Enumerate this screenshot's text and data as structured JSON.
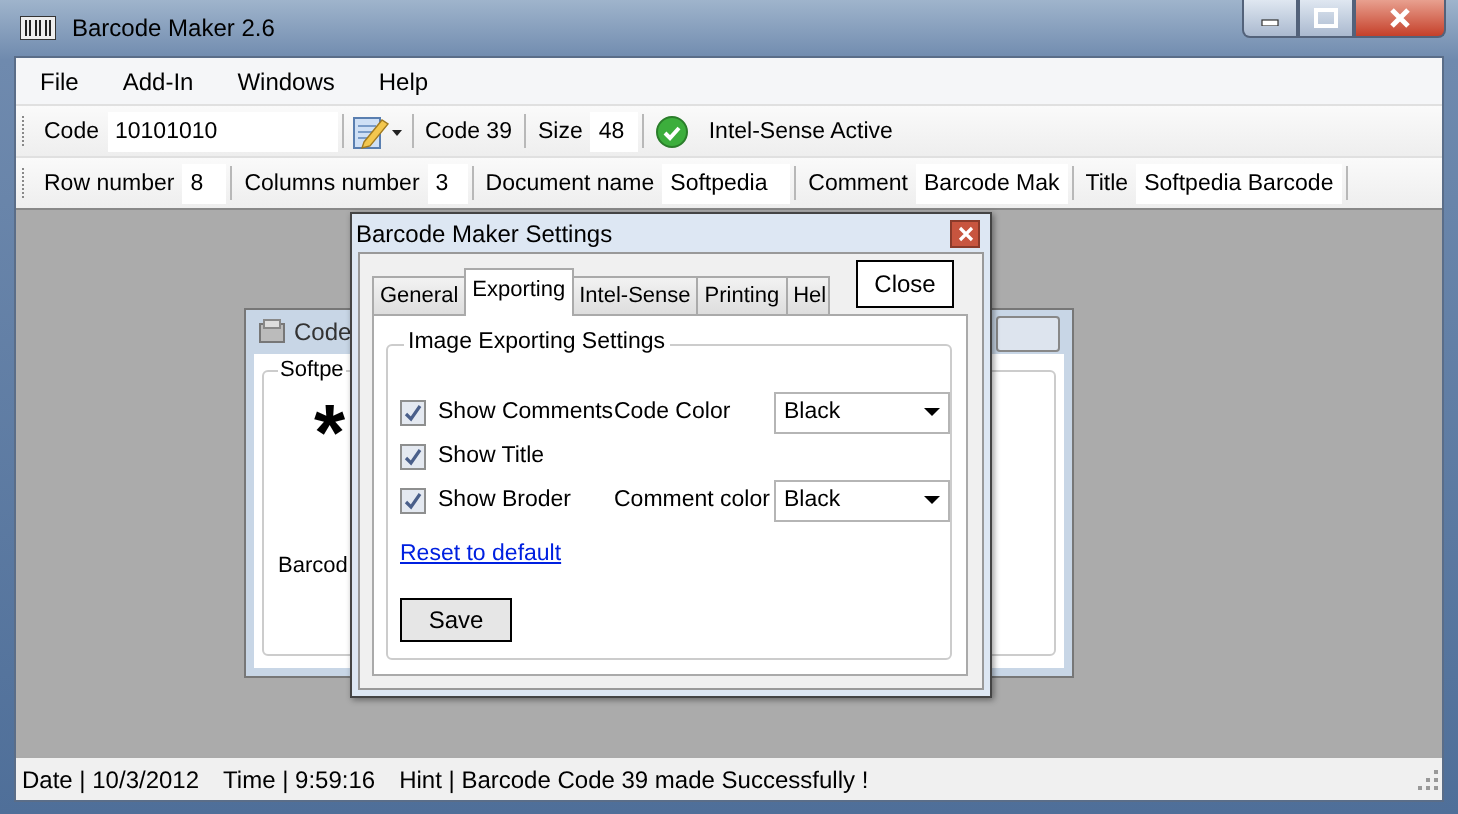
{
  "window": {
    "title": "Barcode Maker 2.6"
  },
  "menu": [
    "File",
    "Add-In",
    "Windows",
    "Help"
  ],
  "toolbar": {
    "code_label": "Code",
    "code_value": "10101010",
    "code_type": "Code 39",
    "size_label": "Size",
    "size_value": "48",
    "status": "Intel-Sense Active"
  },
  "fields": [
    {
      "label": "Row number",
      "value": "8"
    },
    {
      "label": "Columns number",
      "value": "3"
    },
    {
      "label": "Document name",
      "value": "Softpedia"
    },
    {
      "label": "Comment",
      "value": "Barcode Mak"
    },
    {
      "label": "Title",
      "value": "Softpedia Barcode"
    }
  ],
  "child_window": {
    "title": "Code",
    "group": "Softpe",
    "symbol": "*",
    "caption": "Barcod"
  },
  "dialog": {
    "title": "Barcode Maker Settings",
    "tabs": [
      {
        "label": "General",
        "selected": false
      },
      {
        "label": "Exporting",
        "selected": true
      },
      {
        "label": "Intel-Sense",
        "selected": false
      },
      {
        "label": "Printing",
        "selected": false
      },
      {
        "label": "Hel",
        "selected": false
      }
    ],
    "close_button": "Close",
    "group": "Image Exporting Settings",
    "rows": [
      {
        "label": "Show Comments",
        "checked": true,
        "setting": {
          "label": "Code Color",
          "value": "Black"
        }
      },
      {
        "label": "Show Title",
        "checked": true
      },
      {
        "label": "Show Broder",
        "checked": true,
        "setting": {
          "label": "Comment color",
          "value": "Black"
        }
      }
    ],
    "reset_link": "Reset to default",
    "save_button": "Save"
  },
  "status_bar": [
    "Date | 10/3/2012",
    "Time | 9:59:16",
    "Hint | Barcode Code 39 made Successfully !"
  ]
}
